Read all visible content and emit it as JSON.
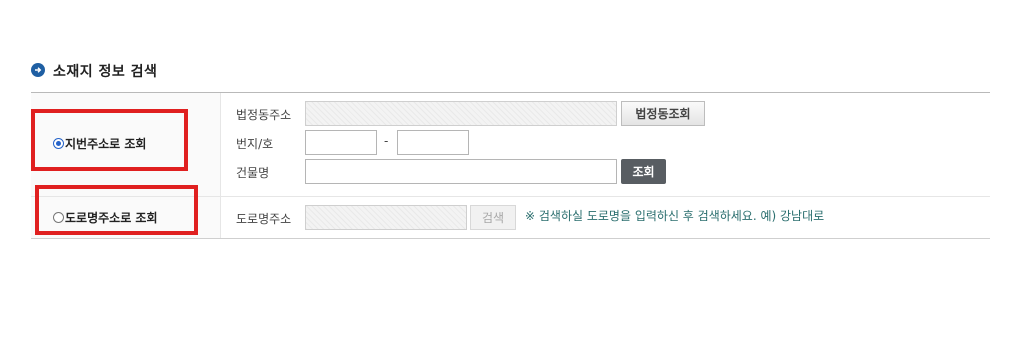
{
  "section": {
    "title": "소재지 정보 검색",
    "icon": "arrow-circle-icon",
    "icon_color": "#1f5fa3"
  },
  "options": {
    "jibun": {
      "label": "지번주소로 조회",
      "selected": true
    },
    "road": {
      "label": "도로명주소로 조회",
      "selected": false
    }
  },
  "jibun_form": {
    "legal_dong_label": "법정동주소",
    "legal_dong_value": "",
    "legal_dong_button": "법정동조회",
    "lot_label": "번지/호",
    "lot_main_value": "",
    "lot_separator": "-",
    "lot_sub_value": "",
    "building_label": "건물명",
    "building_value": "",
    "search_button": "조회"
  },
  "road_form": {
    "road_label": "도로명주소",
    "road_value": "",
    "search_button": "검색",
    "notice": "※ 검색하실 도로명을 입력하신 후 검색하세요. 예) 강남대로"
  },
  "colors": {
    "highlight_border": "#e02020",
    "dark_button": "#585d62",
    "notice_text": "#2a6e6e"
  }
}
